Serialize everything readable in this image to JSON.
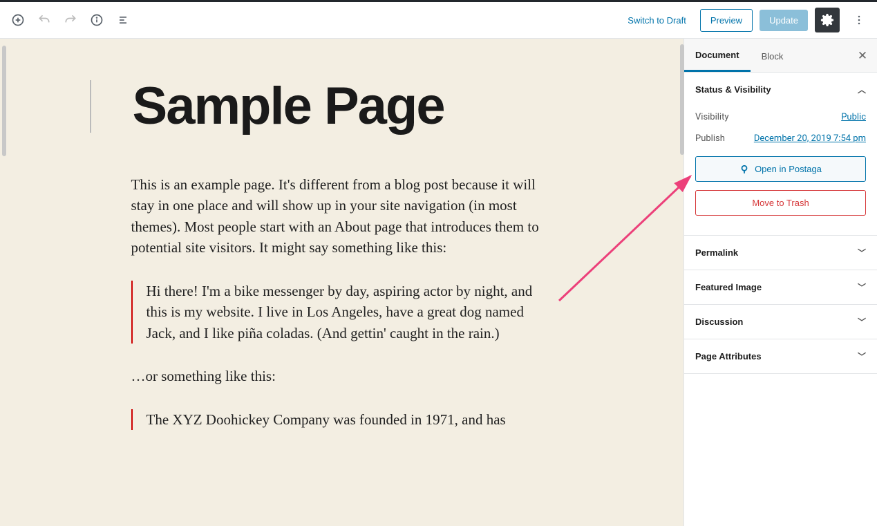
{
  "toolbar": {
    "switch_to_draft": "Switch to Draft",
    "preview": "Preview",
    "update": "Update"
  },
  "editor": {
    "title": "Sample Page",
    "paragraph1": "This is an example page. It's different from a blog post because it will stay in one place and will show up in your site navigation (in most themes). Most people start with an About page that introduces them to potential site visitors. It might say something like this:",
    "blockquote1": "Hi there! I'm a bike messenger by day, aspiring actor by night, and this is my website. I live in Los Angeles, have a great dog named Jack, and I like piña coladas. (And gettin' caught in the rain.)",
    "paragraph2": "…or something like this:",
    "blockquote2": "The XYZ Doohickey Company was founded in 1971, and has"
  },
  "sidebar": {
    "tabs": {
      "document": "Document",
      "block": "Block"
    },
    "status_visibility": {
      "heading": "Status & Visibility",
      "visibility_label": "Visibility",
      "visibility_value": "Public",
      "publish_label": "Publish",
      "publish_value": "December 20, 2019 7:54 pm",
      "open_postaga": "Open in Postaga",
      "move_trash": "Move to Trash"
    },
    "permalink": "Permalink",
    "featured_image": "Featured Image",
    "discussion": "Discussion",
    "page_attributes": "Page Attributes"
  }
}
